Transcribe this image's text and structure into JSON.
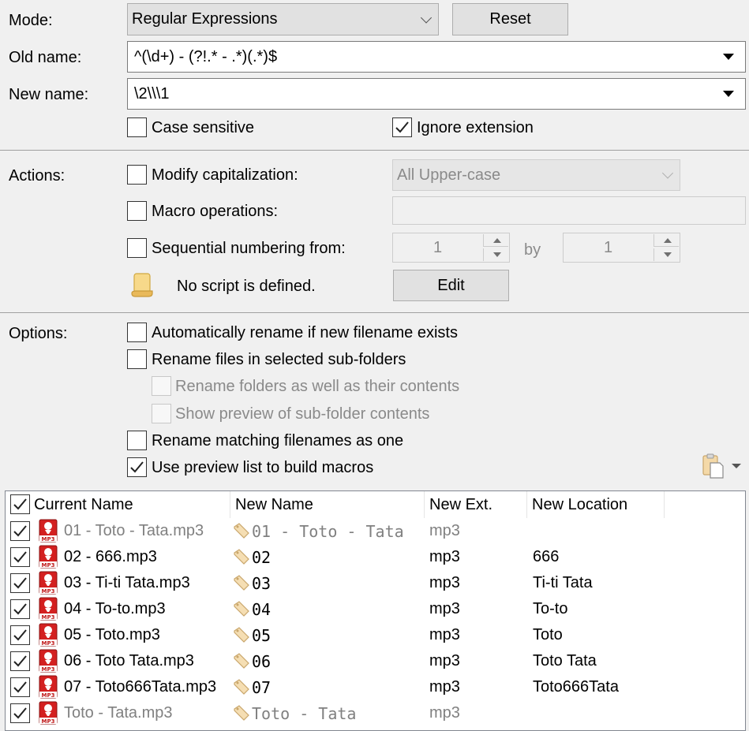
{
  "mode": {
    "label": "Mode:",
    "value": "Regular Expressions",
    "reset_label": "Reset"
  },
  "old_name": {
    "label": "Old name:",
    "value": "^(\\d+) - (?!.* - .*)(.*)$"
  },
  "new_name": {
    "label": "New name:",
    "value": "\\2\\\\\\1"
  },
  "case_sensitive": {
    "label": "Case sensitive",
    "checked": false
  },
  "ignore_extension": {
    "label": "Ignore extension",
    "checked": true
  },
  "actions": {
    "label": "Actions:",
    "modify_cap": {
      "label": "Modify capitalization:",
      "checked": false,
      "value": "All Upper-case"
    },
    "macro_ops": {
      "label": "Macro operations:",
      "checked": false,
      "value": ""
    },
    "sequential": {
      "label": "Sequential numbering from:",
      "checked": false,
      "from": "1",
      "by_label": "by",
      "by": "1"
    },
    "script": {
      "text": "No script is defined.",
      "edit_label": "Edit",
      "icon": "script-icon"
    }
  },
  "options": {
    "label": "Options:",
    "items": [
      {
        "label": "Automatically rename if new filename exists",
        "checked": false,
        "disabled": false
      },
      {
        "label": "Rename files in selected sub-folders",
        "checked": false,
        "disabled": false
      },
      {
        "label": "Rename folders as well as their contents",
        "checked": false,
        "disabled": true
      },
      {
        "label": "Show preview of sub-folder contents",
        "checked": false,
        "disabled": true
      },
      {
        "label": "Rename matching filenames as one",
        "checked": false,
        "disabled": false
      },
      {
        "label": "Use preview list to build macros",
        "checked": true,
        "disabled": false
      }
    ],
    "clipboard_icon": "clipboard-icon"
  },
  "table": {
    "headers": [
      "Current Name",
      "New Name",
      "New Ext.",
      "New Location"
    ],
    "header_checked": true,
    "rows": [
      {
        "current": "01 - Toto - Tata.mp3",
        "new_name": "01 - Toto - Tata",
        "ext": "mp3",
        "location": "",
        "dim": true
      },
      {
        "current": "02 - 666.mp3",
        "new_name": "02",
        "ext": "mp3",
        "location": "666",
        "dim": false
      },
      {
        "current": "03 - Ti-ti Tata.mp3",
        "new_name": "03",
        "ext": "mp3",
        "location": "Ti-ti Tata",
        "dim": false
      },
      {
        "current": "04 - To-to.mp3",
        "new_name": "04",
        "ext": "mp3",
        "location": "To-to",
        "dim": false
      },
      {
        "current": "05 - Toto.mp3",
        "new_name": "05",
        "ext": "mp3",
        "location": "Toto",
        "dim": false
      },
      {
        "current": "06 - Toto Tata.mp3",
        "new_name": "06",
        "ext": "mp3",
        "location": "Toto Tata",
        "dim": false
      },
      {
        "current": "07 - Toto666Tata.mp3",
        "new_name": "07",
        "ext": "mp3",
        "location": "Toto666Tata",
        "dim": false
      },
      {
        "current": "Toto - Tata.mp3",
        "new_name": "Toto - Tata",
        "ext": "mp3",
        "location": "",
        "dim": true
      }
    ],
    "file_icon": "mp3-file-icon",
    "tag_icon": "rename-tag-icon",
    "file_icon_text": "MP3"
  }
}
